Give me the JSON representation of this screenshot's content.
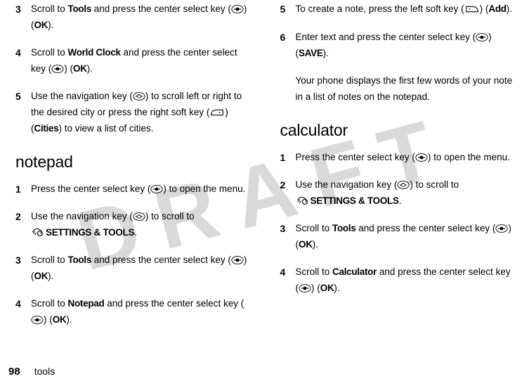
{
  "watermark": "DRAFT",
  "footer": {
    "page": "98",
    "section": "tools"
  },
  "labels": {
    "ok": "OK",
    "add": "Add",
    "save": "SAVE",
    "cities": "Cities",
    "tools": "Tools",
    "world_clock": "World Clock",
    "notepad": "Notepad",
    "calculator": "Calculator",
    "settings_tools": "SETTINGS & TOOLS"
  },
  "headings": {
    "notepad": "notepad",
    "calculator": "calculator"
  },
  "left": {
    "s3a": "Scroll to ",
    "s3b": " and press the center select key (",
    "s3c": ") (",
    "s3d": ").",
    "s4a": "Scroll to ",
    "s4b": " and press the center select key (",
    "s4c": ") (",
    "s4d": ").",
    "s5a": "Use the navigation key (",
    "s5b": ") to scroll left or right to the desired city or press the right soft key (",
    "s5c": ") (",
    "s5d": ") to view a list of cities.",
    "n1a": "Press the center select key (",
    "n1b": ") to open the menu.",
    "n2a": "Use the navigation key (",
    "n2b": ") to scroll to ",
    "n2c": ".",
    "n3a": "Scroll to ",
    "n3b": " and press the center select key (",
    "n3c": ") (",
    "n3d": ").",
    "n4a": "Scroll to ",
    "n4b": " and press the center select key (",
    "n4c": ") (",
    "n4d": ")."
  },
  "right": {
    "s5a": "To create a note, press the left soft key (",
    "s5b": ") (",
    "s5c": ").",
    "s6a": "Enter text and press the center select key (",
    "s6b": ") (",
    "s6c": ").",
    "note": "Your phone displays the first few words of your note in a list of notes on the notepad.",
    "c1a": "Press the center select key (",
    "c1b": ") to open the menu.",
    "c2a": "Use the navigation key (",
    "c2b": ") to scroll to ",
    "c2c": ".",
    "c3a": "Scroll to ",
    "c3b": " and press the center select key (",
    "c3c": ") (",
    "c3d": ").",
    "c4a": "Scroll to ",
    "c4b": " and press the center select key (",
    "c4c": ") (",
    "c4d": ")."
  },
  "nums": {
    "l3": "3",
    "l4": "4",
    "l5": "5",
    "n1": "1",
    "n2": "2",
    "n3": "3",
    "n4": "4",
    "r5": "5",
    "r6": "6",
    "c1": "1",
    "c2": "2",
    "c3": "3",
    "c4": "4"
  }
}
